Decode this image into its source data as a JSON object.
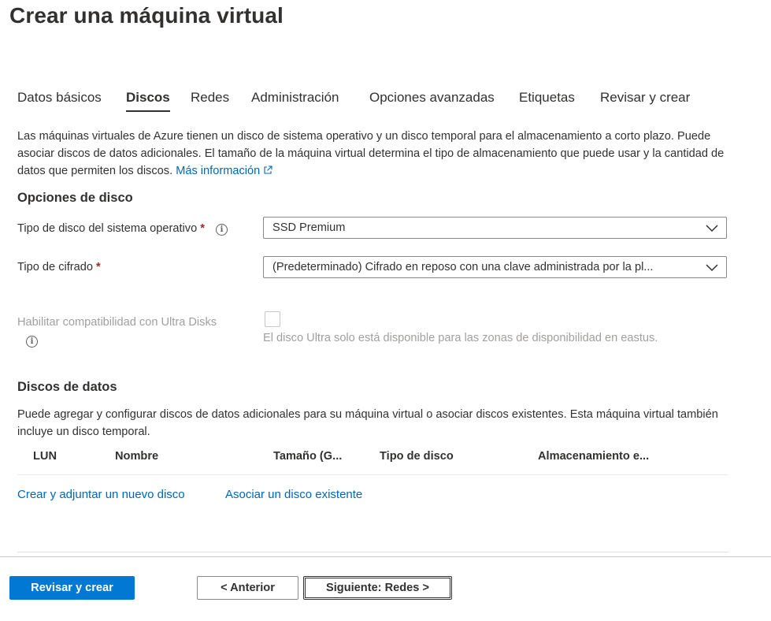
{
  "page": {
    "title": "Crear una máquina virtual"
  },
  "tabs": [
    {
      "label": "Datos básicos",
      "active": false
    },
    {
      "label": "Discos",
      "active": true
    },
    {
      "label": "Redes",
      "active": false
    },
    {
      "label": "Administración",
      "active": false
    },
    {
      "label": "Opciones avanzadas",
      "active": false
    },
    {
      "label": "Etiquetas",
      "active": false
    },
    {
      "label": "Revisar y crear",
      "active": false
    }
  ],
  "intro": {
    "text": "Las máquinas virtuales de Azure tienen un disco de sistema operativo y un disco temporal para el almacenamiento a corto plazo. Puede asociar discos de datos adicionales. El tamaño de la máquina virtual determina el tipo de almacenamiento que puede usar y la cantidad de datos que permiten los discos.",
    "link_label": "Más información",
    "link_icon": "external-link-icon"
  },
  "disk_options": {
    "heading": "Opciones de disco",
    "os_disk_type": {
      "label": "Tipo de disco del sistema operativo",
      "required_mark": "*",
      "info_icon": "info-icon",
      "value": "SSD Premium"
    },
    "encryption_type": {
      "label": "Tipo de cifrado",
      "required_mark": "*",
      "value": "(Predeterminado) Cifrado en reposo con una clave administrada por la pl..."
    },
    "ultra_disks": {
      "label": "Habilitar compatibilidad con Ultra Disks",
      "info_icon": "info-icon",
      "checked": false,
      "disabled": true,
      "hint": "El disco Ultra solo está disponible para las zonas de disponibilidad en eastus."
    }
  },
  "data_disks": {
    "heading": "Discos de datos",
    "description": "Puede agregar y configurar discos de datos adicionales para su máquina virtual o asociar discos existentes. Esta máquina virtual también incluye un disco temporal.",
    "columns": [
      "LUN",
      "Nombre",
      "Tamaño (G...",
      "Tipo de disco",
      "Almacenamiento e..."
    ],
    "rows": [],
    "create_link": "Crear y adjuntar un nuevo disco",
    "attach_link": "Asociar un disco existente"
  },
  "footer": {
    "review_create": "Revisar y crear",
    "previous": "< Anterior",
    "next": "Siguiente: Redes >"
  },
  "colors": {
    "primary": "#0078d4",
    "link": "#0066b8",
    "required": "#a4262c",
    "disabled": "#a19f9d"
  }
}
